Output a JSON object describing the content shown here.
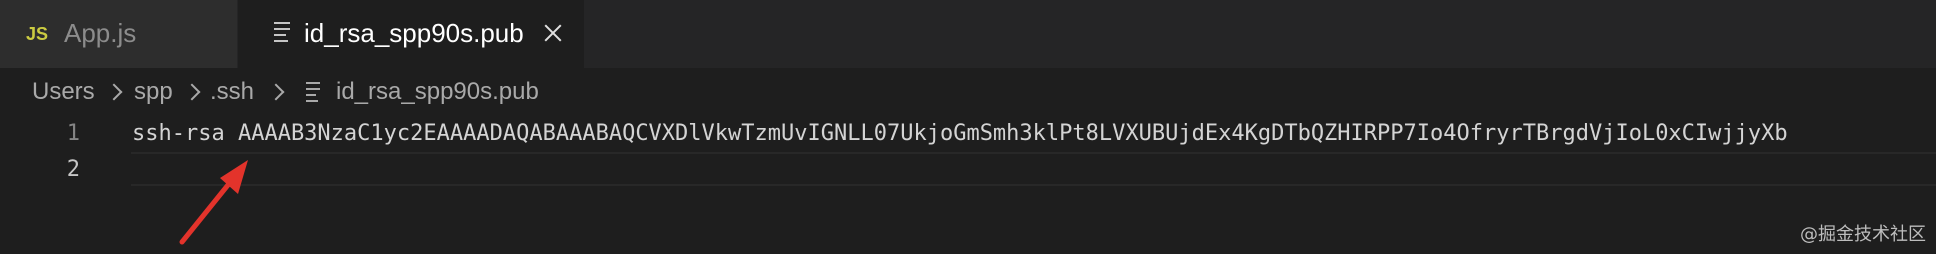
{
  "tabs": [
    {
      "label": "App.js",
      "icon": "JS",
      "active": false
    },
    {
      "label": "id_rsa_spp90s.pub",
      "active": true
    }
  ],
  "breadcrumb": {
    "items": [
      "Users",
      "spp",
      ".ssh",
      "id_rsa_spp90s.pub"
    ]
  },
  "editor": {
    "lines": [
      {
        "number": "1",
        "text": "ssh-rsa AAAAB3NzaC1yc2EAAAADAQABAAABAQCVXDlVkwTzmUvIGNLL07UkjoGmSmh3klPt8LVXUBUjdEx4KgDTbQZHIRPP7Io4OfryrTBrgdVjIoL0xCIwjjyXb"
      },
      {
        "number": "2",
        "text": ""
      }
    ]
  },
  "watermark": "@掘金技术社区",
  "colors": {
    "background": "#1e1e1e",
    "tabbar": "#252526",
    "annotation_arrow": "#e3332b",
    "js_icon": "#cbcb41"
  }
}
